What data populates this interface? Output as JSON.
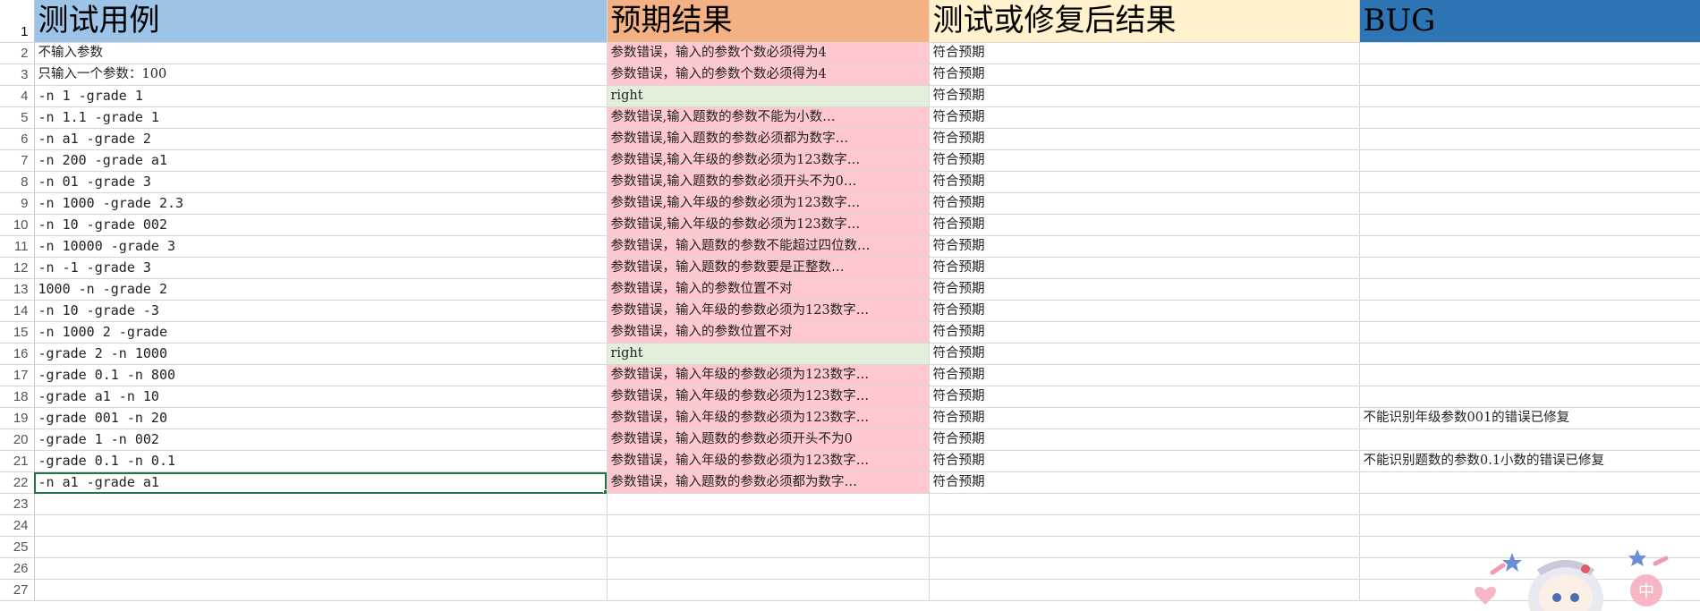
{
  "headers": {
    "a": "测试用例",
    "b": "预期结果",
    "c": "测试或修复后结果",
    "d": "BUG"
  },
  "row_numbers": [
    "1",
    "2",
    "3",
    "4",
    "5",
    "6",
    "7",
    "8",
    "9",
    "10",
    "11",
    "12",
    "13",
    "14",
    "15",
    "16",
    "17",
    "18",
    "19",
    "20",
    "21",
    "22",
    "23",
    "24",
    "25",
    "26",
    "27"
  ],
  "rows": [
    {
      "a": "不输入参数",
      "b": "参数错误，输入的参数个数必须得为4",
      "c": "符合预期",
      "d": "",
      "status": "err"
    },
    {
      "a": "只输入一个参数：100",
      "b": "参数错误，输入的参数个数必须得为4",
      "c": "符合预期",
      "d": "",
      "status": "err"
    },
    {
      "a": " -n 1 -grade 1",
      "b": "right",
      "c": "符合预期",
      "d": "",
      "status": "ok"
    },
    {
      "a": " -n 1.1 -grade 1",
      "b": "参数错误,输入题数的参数不能为小数…",
      "c": "符合预期",
      "d": "",
      "status": "err"
    },
    {
      "a": " -n a1 -grade 2",
      "b": "参数错误,输入题数的参数必须都为数字…",
      "c": "符合预期",
      "d": "",
      "status": "err"
    },
    {
      "a": " -n 200 -grade a1",
      "b": "参数错误,输入年级的参数必须为123数字…",
      "c": "符合预期",
      "d": "",
      "status": "err"
    },
    {
      "a": " -n 01 -grade 3",
      "b": "参数错误,输入题数的参数必须开头不为0…",
      "c": "符合预期",
      "d": "",
      "status": "err"
    },
    {
      "a": " -n 1000 -grade 2.3",
      "b": "参数错误,输入年级的参数必须为123数字…",
      "c": "符合预期",
      "d": "",
      "status": "err"
    },
    {
      "a": " -n 10 -grade 002",
      "b": "参数错误,输入年级的参数必须为123数字…",
      "c": "符合预期",
      "d": "",
      "status": "err"
    },
    {
      "a": " -n 10000 -grade 3",
      "b": "参数错误，输入题数的参数不能超过四位数…",
      "c": "符合预期",
      "d": "",
      "status": "err"
    },
    {
      "a": " -n -1 -grade 3",
      "b": "参数错误，输入题数的参数要是正整数…",
      "c": "符合预期",
      "d": "",
      "status": "err"
    },
    {
      "a": " 1000 -n -grade 2",
      "b": "参数错误，输入的参数位置不对",
      "c": "符合预期",
      "d": "",
      "status": "err"
    },
    {
      "a": " -n 10 -grade -3",
      "b": "参数错误，输入年级的参数必须为123数字…",
      "c": "符合预期",
      "d": "",
      "status": "err"
    },
    {
      "a": " -n 1000 2 -grade",
      "b": "参数错误，输入的参数位置不对",
      "c": "符合预期",
      "d": "",
      "status": "err"
    },
    {
      "a": " -grade 2 -n 1000",
      "b": "right",
      "c": "符合预期",
      "d": "",
      "status": "ok"
    },
    {
      "a": " -grade 0.1 -n 800",
      "b": "参数错误，输入年级的参数必须为123数字…",
      "c": "符合预期",
      "d": "",
      "status": "err"
    },
    {
      "a": " -grade a1 -n 10",
      "b": "参数错误，输入年级的参数必须为123数字…",
      "c": "符合预期",
      "d": "",
      "status": "err"
    },
    {
      "a": " -grade 001 -n 20",
      "b": "参数错误，输入年级的参数必须为123数字…",
      "c": "符合预期",
      "d": "不能识别年级参数001的错误已修复",
      "status": "err"
    },
    {
      "a": " -grade 1 -n 002",
      "b": "参数错误，输入题数的参数必须开头不为0",
      "c": "符合预期",
      "d": "",
      "status": "err"
    },
    {
      "a": " -grade 0.1 -n 0.1",
      "b": "参数错误，输入年级的参数必须为123数字…",
      "c": "符合预期",
      "d": "不能识别题数的参数0.1小数的错误已修复",
      "status": "err"
    },
    {
      "a": " -n a1 -grade a1",
      "b": "参数错误，输入题数的参数必须都为数字…",
      "c": "符合预期",
      "d": "",
      "status": "err"
    }
  ],
  "empty_rows": 5,
  "colors": {
    "header_a": "#9dc3e6",
    "header_b": "#f4b183",
    "header_c": "#fff2cc",
    "header_d": "#2e75b6",
    "error_fill": "#ffc7ce",
    "ok_fill": "#e2efda",
    "selection": "#217346"
  },
  "selected_cell_row": 22,
  "decoration": {
    "mascot_label": "中"
  }
}
